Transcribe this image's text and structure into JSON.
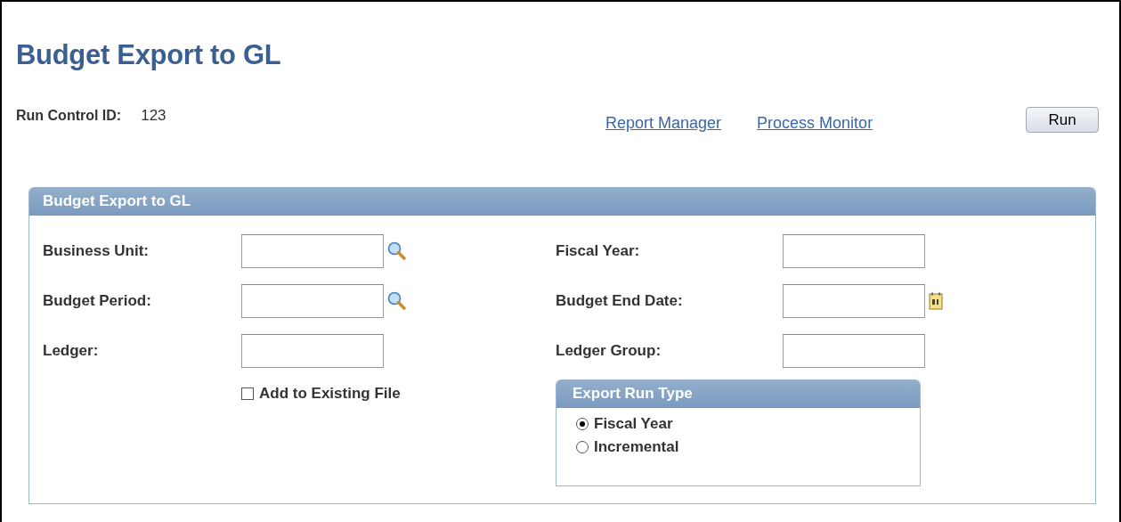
{
  "page": {
    "title": "Budget Export to GL"
  },
  "run_control": {
    "label": "Run Control ID:",
    "value": "123"
  },
  "links": [
    "Report Manager",
    "Process Monitor"
  ],
  "buttons": [
    "Run"
  ],
  "group": {
    "title": "Budget Export to GL",
    "left_fields": [
      {
        "label": "Business Unit:",
        "kind": "lookup"
      },
      {
        "label": "Budget Period:",
        "kind": "lookup"
      },
      {
        "label": "Ledger:",
        "kind": "plain"
      }
    ],
    "right_fields": [
      {
        "label": "Fiscal Year:",
        "kind": "plain"
      },
      {
        "label": "Budget End Date:",
        "kind": "date"
      },
      {
        "label": "Ledger Group:",
        "kind": "plain"
      }
    ],
    "checkbox": {
      "label": "Add to Existing File",
      "checked": false
    },
    "export_run_type": {
      "title": "Export Run Type",
      "options": [
        {
          "label": "Fiscal Year",
          "selected": true
        },
        {
          "label": "Incremental",
          "selected": false
        }
      ]
    }
  }
}
